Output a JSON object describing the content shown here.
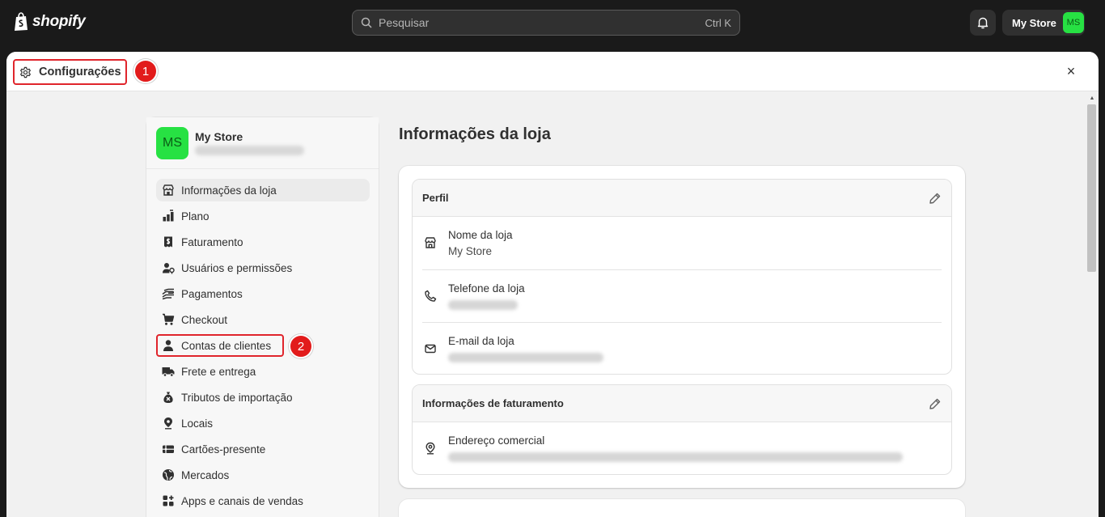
{
  "topbar": {
    "brand": "shopify",
    "search_placeholder": "Pesquisar",
    "search_shortcut": "Ctrl K",
    "store_name": "My Store",
    "store_initials": "MS"
  },
  "modal": {
    "title": "Configurações",
    "annotation_1": "1",
    "annotation_2": "2",
    "close_label": "×"
  },
  "sidebar": {
    "store_name": "My Store",
    "store_initials": "MS",
    "items": [
      {
        "label": "Informações da loja",
        "icon": "store-icon"
      },
      {
        "label": "Plano",
        "icon": "plan-icon"
      },
      {
        "label": "Faturamento",
        "icon": "billing-icon"
      },
      {
        "label": "Usuários e permissões",
        "icon": "users-icon"
      },
      {
        "label": "Pagamentos",
        "icon": "payments-icon"
      },
      {
        "label": "Checkout",
        "icon": "cart-icon"
      },
      {
        "label": "Contas de clientes",
        "icon": "person-icon"
      },
      {
        "label": "Frete e entrega",
        "icon": "truck-icon"
      },
      {
        "label": "Tributos de importação",
        "icon": "duties-icon"
      },
      {
        "label": "Locais",
        "icon": "location-icon"
      },
      {
        "label": "Cartões-presente",
        "icon": "gift-card-icon"
      },
      {
        "label": "Mercados",
        "icon": "globe-icon"
      },
      {
        "label": "Apps e canais de vendas",
        "icon": "apps-icon"
      }
    ]
  },
  "main": {
    "page_title": "Informações da loja",
    "profile": {
      "title": "Perfil",
      "store_name_label": "Nome da loja",
      "store_name_value": "My Store",
      "phone_label": "Telefone da loja",
      "email_label": "E-mail da loja"
    },
    "billing": {
      "title": "Informações de faturamento",
      "address_label": "Endereço comercial"
    }
  },
  "colors": {
    "brand_green": "#27e143",
    "annotation_red": "#e21b1b"
  }
}
